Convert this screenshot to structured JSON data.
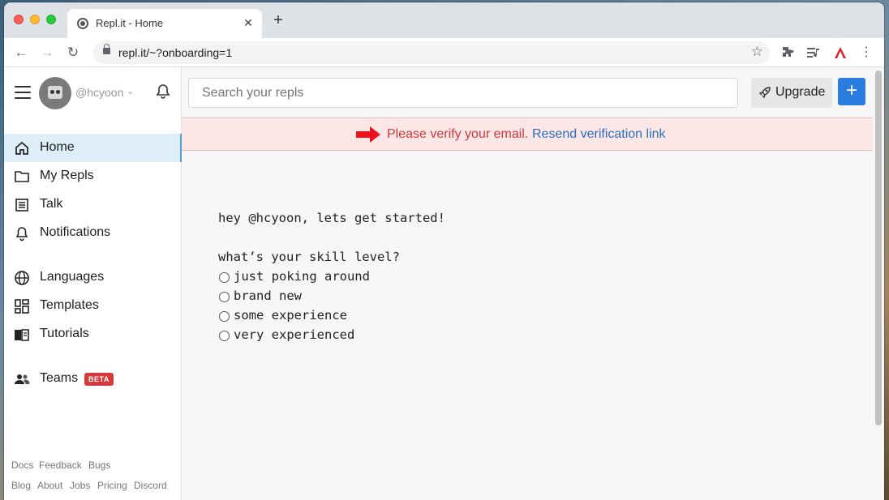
{
  "browser": {
    "tab_title": "Repl.it - Home",
    "url": "repl.it/~?onboarding=1"
  },
  "sidebar": {
    "username": "@hcyoon",
    "nav": [
      {
        "label": "Home",
        "icon": "home-icon",
        "active": true
      },
      {
        "label": "My Repls",
        "icon": "folder-icon"
      },
      {
        "label": "Talk",
        "icon": "list-icon"
      },
      {
        "label": "Notifications",
        "icon": "bell-icon"
      },
      {
        "label": "Languages",
        "icon": "globe-icon"
      },
      {
        "label": "Templates",
        "icon": "templates-icon"
      },
      {
        "label": "Tutorials",
        "icon": "book-icon"
      },
      {
        "label": "Teams",
        "icon": "users-icon",
        "badge": "BETA"
      }
    ],
    "footer_row1": [
      "Docs",
      "Feedback",
      "Bugs"
    ],
    "footer_row2": [
      "Blog",
      "About",
      "Jobs",
      "Pricing",
      "Discord"
    ]
  },
  "header": {
    "search_placeholder": "Search your repls",
    "upgrade_label": "Upgrade",
    "new_button": "+"
  },
  "banner": {
    "message": "Please verify your email.",
    "link": "Resend verification link"
  },
  "onboarding": {
    "greeting": "hey @hcyoon, lets get started!",
    "question": "what’s your skill level?",
    "options": [
      "just poking around",
      "brand new",
      "some experience",
      "very experienced"
    ]
  },
  "colors": {
    "accent": "#2b7de0",
    "banner_bg": "#fde6e6",
    "banner_text": "#d0383c",
    "link": "#2a6fbf",
    "active_nav": "#ddeef8",
    "beta_badge": "#d53a3a"
  }
}
